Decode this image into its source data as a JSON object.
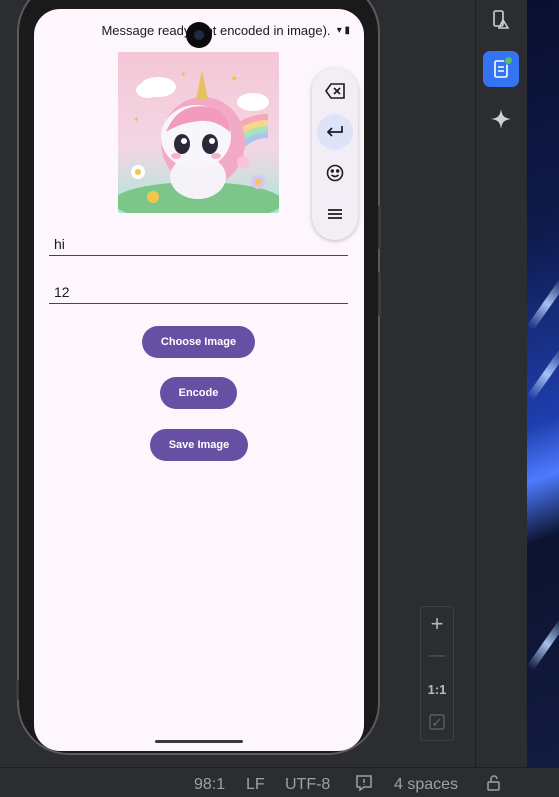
{
  "app": {
    "toast": "Message ready (not encoded in image).",
    "message_field": {
      "value": "hi"
    },
    "key_field": {
      "value": "12"
    },
    "buttons": {
      "choose": "Choose Image",
      "encode": "Encode",
      "save": "Save Image"
    },
    "image_alt": "unicorn image"
  },
  "keyboard_toolbar": {
    "items": [
      "backspace-icon",
      "enter-icon",
      "emoji-icon",
      "menu-icon"
    ]
  },
  "zoom_panel": {
    "zoom_in": "+",
    "zoom_out": "—",
    "ratio": "1:1"
  },
  "status_bar": {
    "position": "98:1",
    "line_ending": "LF",
    "encoding": "UTF-8",
    "indent": "4 spaces"
  },
  "colors": {
    "primary": "#6750a4",
    "screen_bg": "#fdf6fd",
    "ide_bg": "#2b2d30",
    "accent": "#3574f0"
  }
}
